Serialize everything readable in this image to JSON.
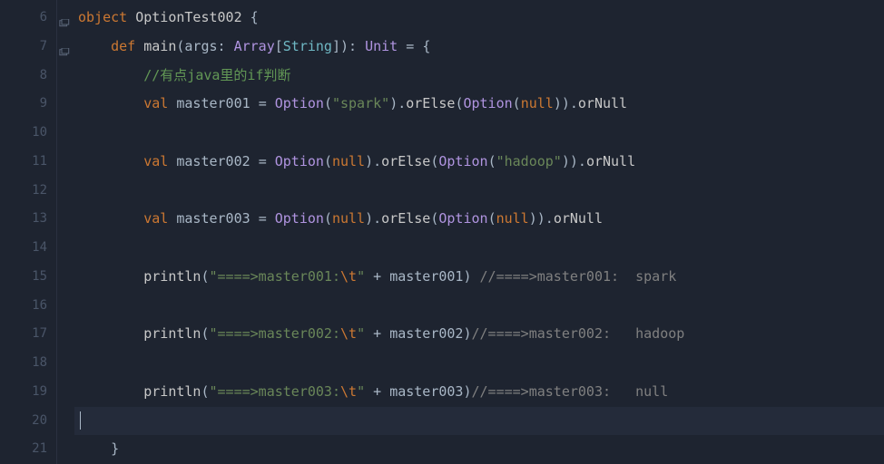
{
  "gutter": {
    "lineNumbers": [
      "6",
      "7",
      "8",
      "9",
      "10",
      "11",
      "12",
      "13",
      "14",
      "15",
      "16",
      "17",
      "18",
      "19",
      "20",
      "21"
    ]
  },
  "code": {
    "l6": {
      "kw1": "object",
      "name": " OptionTest002 ",
      "brace": "{"
    },
    "l7": {
      "kw1": "def",
      "name": " main",
      "p1": "(",
      "arg": "args",
      "colon": ": ",
      "type1": "Array",
      "br1": "[",
      "type2": "String",
      "br2": "]",
      "p2": ")",
      "colon2": ": ",
      "type3": "Unit",
      "eq": " = ",
      "brace": "{"
    },
    "l8": {
      "comment": "//有点java里的if判断"
    },
    "l9": {
      "kw": "val",
      "name": " master001 ",
      "eq": "= ",
      "opt": "Option",
      "p1": "(",
      "str": "\"spark\"",
      "p2": ")",
      "dot1": ".",
      "m1": "orElse",
      "p3": "(",
      "opt2": "Option",
      "p4": "(",
      "null": "null",
      "p5": ")",
      "p6": ")",
      "dot2": ".",
      "m2": "orNull"
    },
    "l11": {
      "kw": "val",
      "name": " master002 ",
      "eq": "= ",
      "opt": "Option",
      "p1": "(",
      "null": "null",
      "p2": ")",
      "dot1": ".",
      "m1": "orElse",
      "p3": "(",
      "opt2": "Option",
      "p4": "(",
      "str": "\"hadoop\"",
      "p5": ")",
      "p6": ")",
      "dot2": ".",
      "m2": "orNull"
    },
    "l13": {
      "kw": "val",
      "name": " master003 ",
      "eq": "= ",
      "opt": "Option",
      "p1": "(",
      "null": "null",
      "p2": ")",
      "dot1": ".",
      "m1": "orElse",
      "p3": "(",
      "opt2": "Option",
      "p4": "(",
      "null2": "null",
      "p5": ")",
      "p6": ")",
      "dot2": ".",
      "m2": "orNull"
    },
    "l15": {
      "m": "println",
      "p1": "(",
      "str1": "\"====>master001:",
      "esc": "\\t",
      "str2": "\"",
      "plus": " + ",
      "var": "master001",
      "p2": ") ",
      "comment": "//====>master001:  spark"
    },
    "l17": {
      "m": "println",
      "p1": "(",
      "str1": "\"====>master002:",
      "esc": "\\t",
      "str2": "\"",
      "plus": " + ",
      "var": "master002",
      "p2": ")",
      "comment": "//====>master002:   hadoop"
    },
    "l19": {
      "m": "println",
      "p1": "(",
      "str1": "\"====>master003:",
      "esc": "\\t",
      "str2": "\"",
      "plus": " + ",
      "var": "master003",
      "p2": ")",
      "comment": "//====>master003:   null"
    },
    "l21": {
      "brace": "}"
    }
  }
}
